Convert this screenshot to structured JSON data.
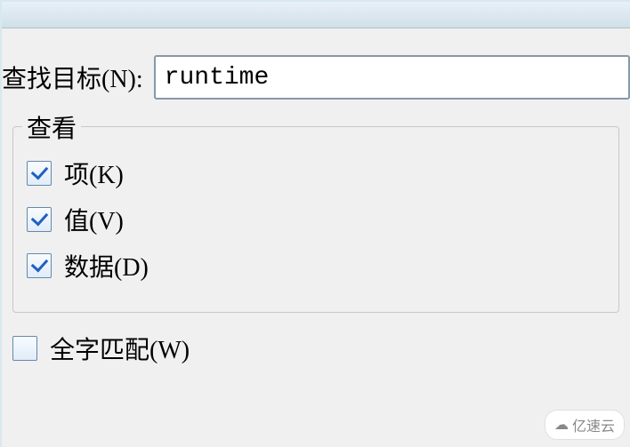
{
  "find": {
    "label": "查找目标(N):",
    "value": "runtime"
  },
  "view": {
    "legend": "查看",
    "items": [
      {
        "label": "项(K)",
        "checked": true
      },
      {
        "label": "值(V)",
        "checked": true
      },
      {
        "label": "数据(D)",
        "checked": true
      }
    ]
  },
  "wholeword": {
    "label": "全字匹配(W)",
    "checked": false
  },
  "watermark": {
    "text": "亿速云"
  }
}
